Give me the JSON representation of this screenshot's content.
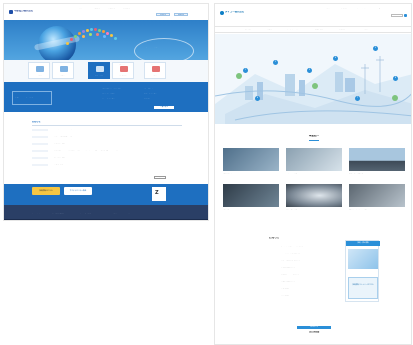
{
  "left_page": {
    "logo_text": "中部電力株式会社",
    "gnav": [
      "お知らせ",
      "企業情報",
      "事業案内",
      "採用情報",
      "お問合せ",
      "English"
    ],
    "hero_caption": "エネルギーと共に",
    "tiles": [
      "ご案内",
      "事業紹介",
      "技術・研究",
      "採用情報",
      "お問合せ"
    ],
    "tile_red": [
      "企業広告",
      "お客さまへ"
    ],
    "blueband_box": "新着ニュースのご案内",
    "blueband_links": [
      "電力安定供給への取り組み",
      "再生可能エネルギー",
      "地域社会への貢献",
      "環境への取り組み",
      "安全への取り組み",
      "技術開発"
    ],
    "blueband_button": "一覧を見る",
    "news_title": "お知らせ",
    "news": [
      {
        "date": "2017.04.01",
        "text": "ホームページをリニューアルしました"
      },
      {
        "date": "2017.03.15",
        "text": "平成28年度の業績を公開しました"
      },
      {
        "date": "2017.03.01",
        "text": "採用情報を更新しました"
      },
      {
        "date": "2017.02.20",
        "text": "新規事業について、詳細情報を公開しました。これからも皆さまの安心を支えていきます。"
      },
      {
        "date": "2017.02.01",
        "text": "会社案内を更新しました"
      },
      {
        "date": "2017.01.10",
        "text": "年頭のご挨拶"
      }
    ],
    "news_more": "一覧へ",
    "banners": [
      "採用情報はこちら",
      "サステナビリティ報告"
    ],
    "banner_logo": "Z",
    "footer_links": [
      "サイトマップ",
      "個人情報保護方針",
      "サイトのご利用について",
      "お問合せ",
      "アクセス"
    ],
    "colors": {
      "primary": "#1e6fc0",
      "footer": "#2a3f66"
    }
  },
  "right_page": {
    "logo_text": "ダイコー株式会社",
    "utility": [
      "お問合せ",
      "採用情報",
      "サイトマップ",
      "English"
    ],
    "gnav": [
      "会社案内",
      "事業紹介",
      "サステナビリティ",
      "投資家情報",
      "採用情報",
      "お問合せ"
    ],
    "illustration_bubbles": [
      "1",
      "2",
      "3",
      "4",
      "5",
      "6",
      "7",
      "8"
    ],
    "business_en": "OUR BUSINESS",
    "business_jp": "事業紹介",
    "business_cards": [
      "電力設備工事",
      "エネルギー事業",
      "環境・再生可能事業",
      "海外事業",
      "設計・施工事業",
      "建設コンサルタント事業"
    ],
    "news_title": "お知らせ",
    "news_sub": "NEWS",
    "news": [
      {
        "date": "2017.04.01",
        "text": "ホームページをリニューアルしました"
      },
      {
        "date": "2017.03.28",
        "text": "ニュースリリースを公開しました"
      },
      {
        "date": "2017.03.15",
        "text": "平成28年度 決算を公開しました"
      },
      {
        "date": "2017.03.01",
        "text": "採用情報を更新しました"
      },
      {
        "date": "2017.02.20",
        "text": "技術開発について公開しました"
      },
      {
        "date": "2017.02.01",
        "text": "会社案内を更新しました"
      },
      {
        "date": "2017.01.15",
        "text": "年頭のご挨拶"
      },
      {
        "date": "2017.01.04",
        "text": "新年のご挨拶"
      }
    ],
    "news_side_top": "採用・求人情報",
    "news_side_button": "採用情報 エントリーはこちら",
    "bottom_en": "PRODUCTS",
    "bottom_jp": "注目商品",
    "colors": {
      "primary": "#2a8fd8"
    }
  }
}
